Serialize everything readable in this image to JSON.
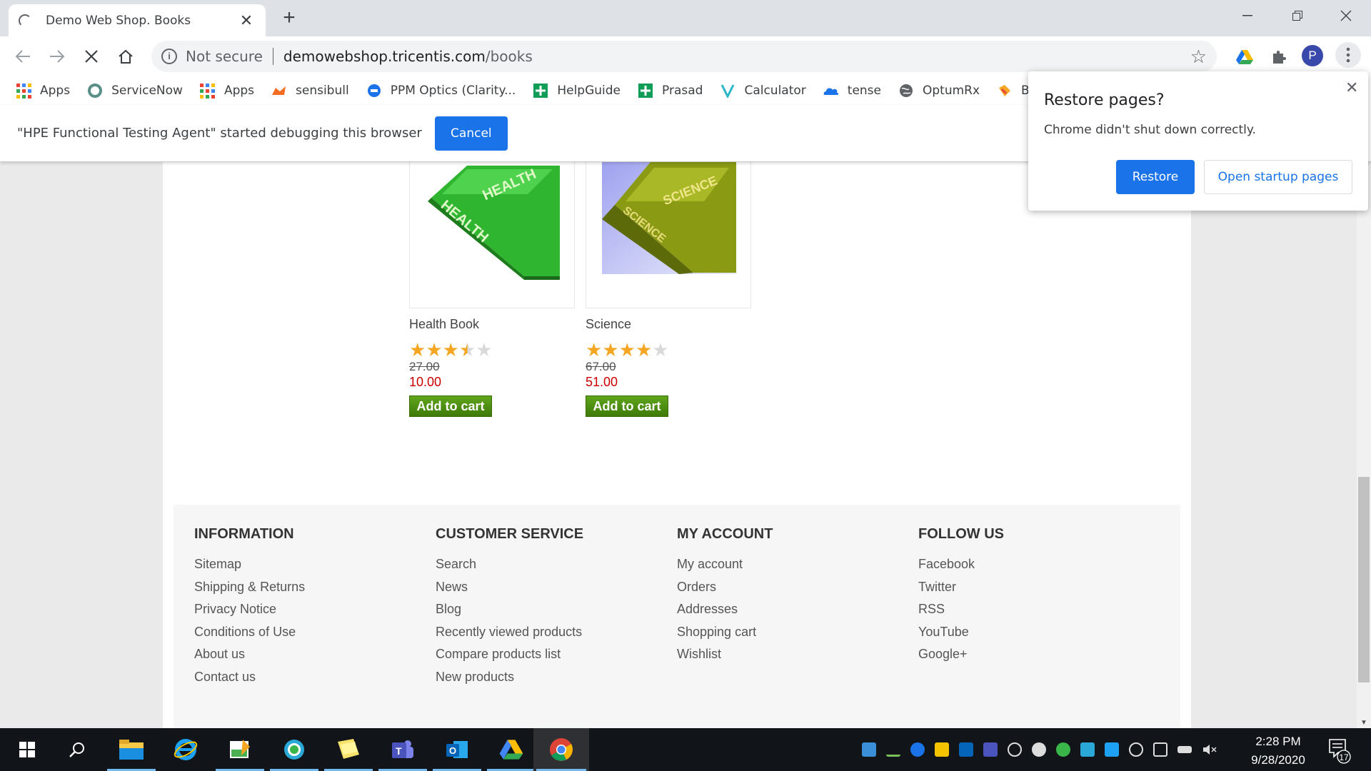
{
  "browser": {
    "tab_title": "Demo Web Shop. Books",
    "tab_close": "✕",
    "new_tab": "+",
    "not_secure": "Not secure",
    "url_host": "demowebshop.tricentis.com",
    "url_path": "/books",
    "profile_initial": "P",
    "bookmarks": [
      {
        "label": "Apps",
        "icon": "apps-grid-icon"
      },
      {
        "label": "ServiceNow",
        "icon": "servicenow-icon"
      },
      {
        "label": "Apps",
        "icon": "apps-grid-icon"
      },
      {
        "label": "sensibull",
        "icon": "sensibull-icon"
      },
      {
        "label": "PPM Optics (Clarity...",
        "icon": "ppm-icon"
      },
      {
        "label": "HelpGuide",
        "icon": "helpguide-icon"
      },
      {
        "label": "Prasad",
        "icon": "plus-green-icon"
      },
      {
        "label": "Calculator",
        "icon": "calculator-v-icon"
      },
      {
        "label": "tense",
        "icon": "cloud-icon"
      },
      {
        "label": "OptumRx",
        "icon": "globe-icon"
      },
      {
        "label": "BPE",
        "icon": "bpe-icon"
      }
    ]
  },
  "infobar": {
    "message": "\"HPE Functional Testing Agent\" started debugging this browser",
    "cancel_label": "Cancel"
  },
  "restore_popup": {
    "title": "Restore pages?",
    "body": "Chrome didn't shut down correctly.",
    "restore_label": "Restore",
    "startup_label": "Open startup pages",
    "close": "✕"
  },
  "products": [
    {
      "name": "Health Book",
      "rating": 0.7,
      "old_price": "27.00",
      "price": "10.00",
      "add_label": "Add to cart",
      "cover_text": "HEALTH"
    },
    {
      "name": "Science",
      "rating": 0.8,
      "old_price": "67.00",
      "price": "51.00",
      "add_label": "Add to cart",
      "cover_text": "SCIENCE"
    }
  ],
  "footer": {
    "columns": [
      {
        "title": "INFORMATION",
        "links": [
          "Sitemap",
          "Shipping & Returns",
          "Privacy Notice",
          "Conditions of Use",
          "About us",
          "Contact us"
        ]
      },
      {
        "title": "CUSTOMER SERVICE",
        "links": [
          "Search",
          "News",
          "Blog",
          "Recently viewed products",
          "Compare products list",
          "New products"
        ]
      },
      {
        "title": "MY ACCOUNT",
        "links": [
          "My account",
          "Orders",
          "Addresses",
          "Shopping cart",
          "Wishlist"
        ]
      },
      {
        "title": "FOLLOW US",
        "links": [
          "Facebook",
          "Twitter",
          "RSS",
          "YouTube",
          "Google+"
        ]
      }
    ]
  },
  "taskbar": {
    "time": "2:28 PM",
    "date": "9/28/2020",
    "notification_count": "17"
  },
  "colors": {
    "accent_blue": "#1a73e8",
    "cart_green": "#4b8a0f",
    "sale_red": "#cc0000",
    "star_gold": "#f5a623"
  }
}
